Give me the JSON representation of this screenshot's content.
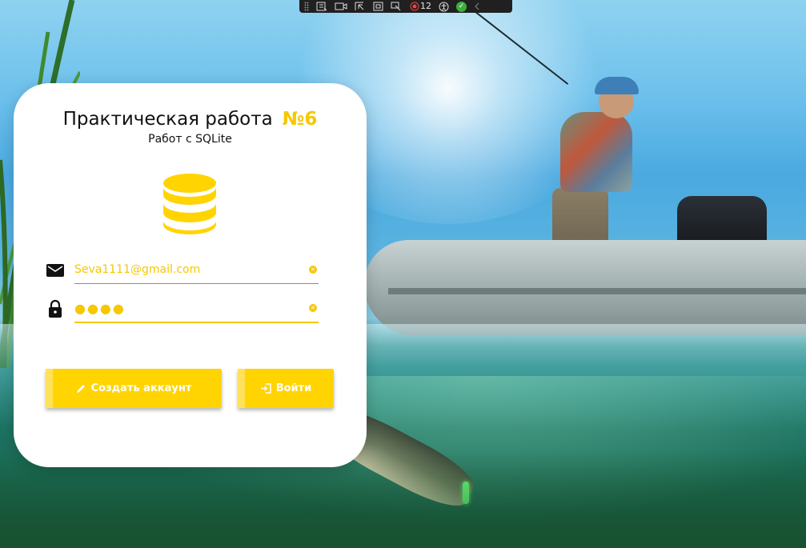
{
  "window": {
    "background_scene": "fisherman-boat-pike"
  },
  "devtools_toolbar": {
    "binding_count": "12",
    "icons": [
      "grip-icon",
      "live-tree-icon",
      "record-icon",
      "select-element-icon",
      "layout-adorner-icon",
      "track-focus-icon",
      "binding-failures-icon",
      "accessibility-icon",
      "check-icon",
      "collapse-icon"
    ]
  },
  "card": {
    "title": "Практическая работа",
    "title_number": "№6",
    "subtitle": "Работ с SQLite",
    "logo_icon": "database-icon"
  },
  "login_form": {
    "email": {
      "value": "Seva1111@gmail.com",
      "icon": "email-icon"
    },
    "password": {
      "value": "●●●●",
      "icon": "lock-icon"
    },
    "create_button": {
      "label": "Создать аккаунт",
      "icon": "pencil-icon"
    },
    "login_button": {
      "label": "Войти",
      "icon": "login-icon"
    }
  },
  "colors": {
    "accent": "#ffd400",
    "card_background": "#ffffff",
    "text": "#111111"
  }
}
